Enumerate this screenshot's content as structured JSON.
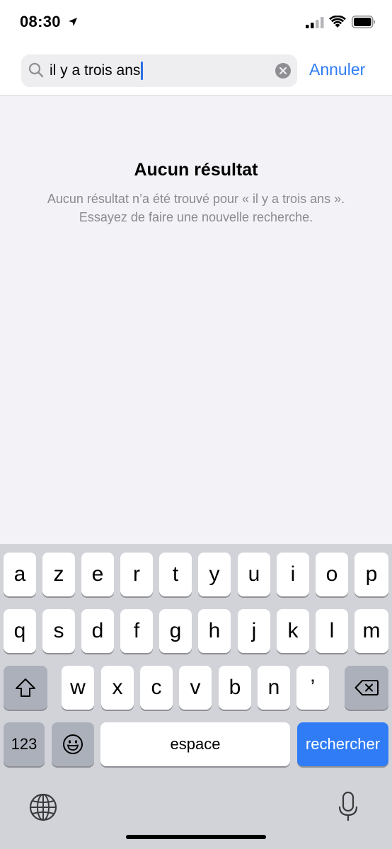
{
  "status_bar": {
    "time": "08:30"
  },
  "search": {
    "query": "il y a trois ans",
    "cancel_label": "Annuler"
  },
  "empty_state": {
    "title": "Aucun résultat",
    "message_line1": "Aucun résultat n’a été trouvé pour « il y a trois ans ».",
    "message_line2": "Essayez de faire une nouvelle recherche."
  },
  "keyboard": {
    "row1": [
      "a",
      "z",
      "e",
      "r",
      "t",
      "y",
      "u",
      "i",
      "o",
      "p"
    ],
    "row2": [
      "q",
      "s",
      "d",
      "f",
      "g",
      "h",
      "j",
      "k",
      "l",
      "m"
    ],
    "row3": [
      "w",
      "x",
      "c",
      "v",
      "b",
      "n",
      "’"
    ],
    "numbers_label": "123",
    "space_label": "espace",
    "search_label": "rechercher"
  },
  "colors": {
    "accent": "#2f7cf6",
    "background": "#f2f2f7",
    "keyboard": "#d1d3d9"
  }
}
